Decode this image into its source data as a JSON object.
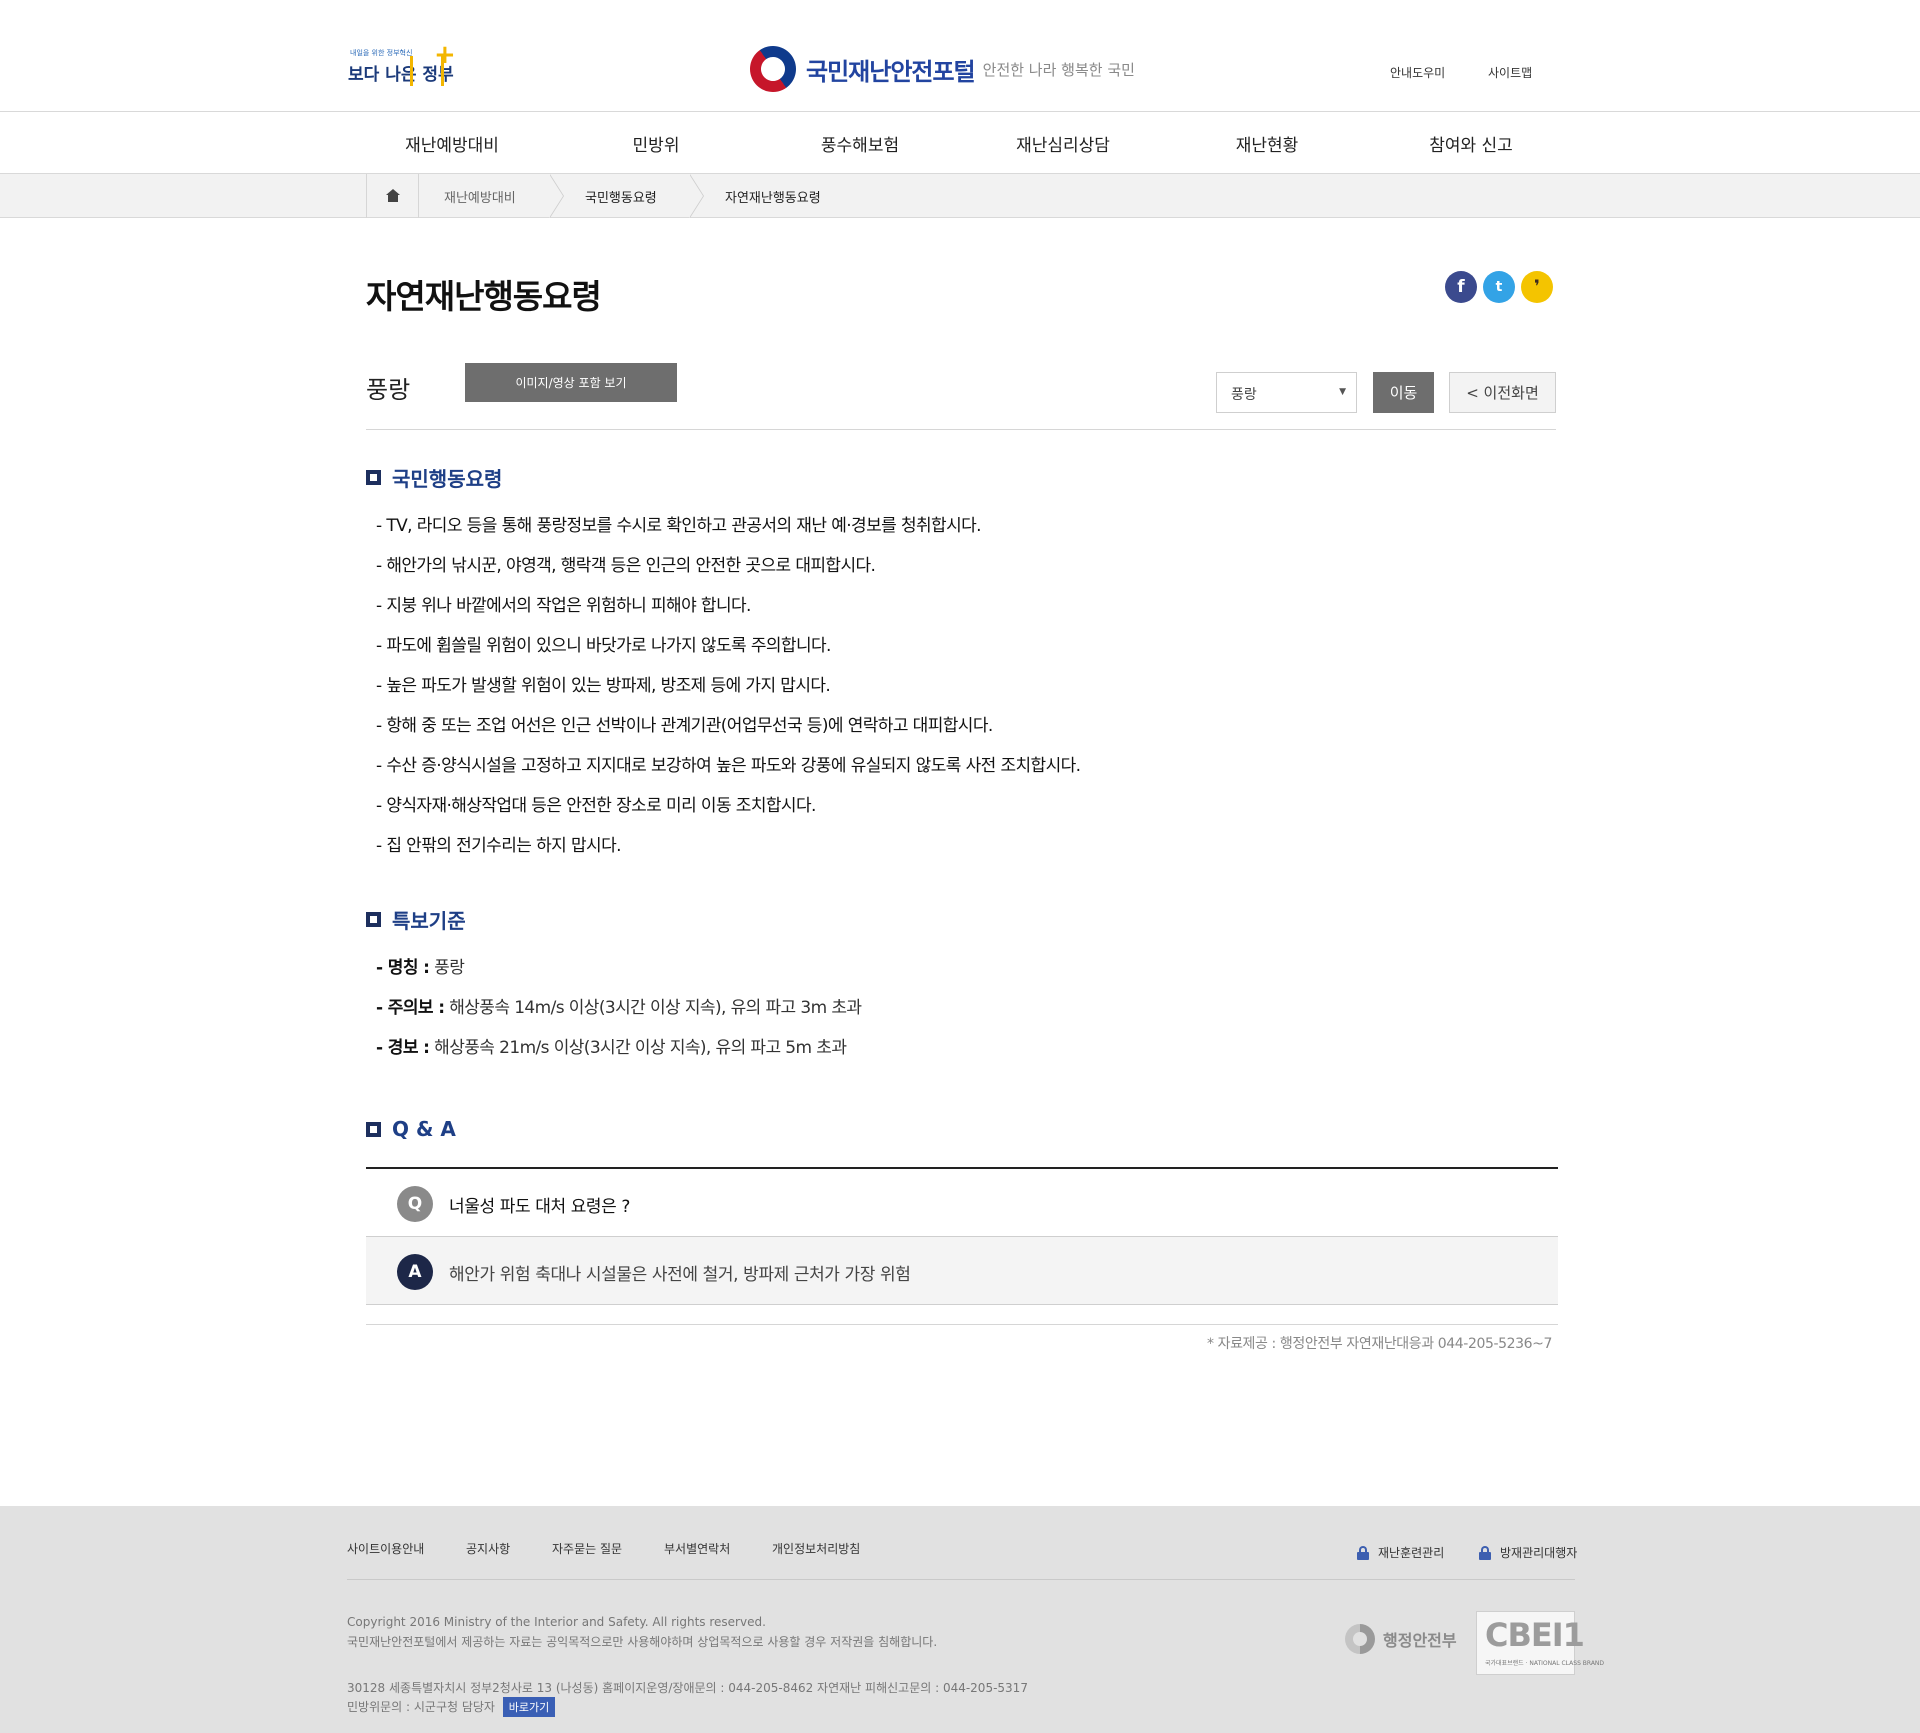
{
  "header": {
    "gov_logo_small": "내일을 위한 정부혁신",
    "gov_logo_big": "보다 나은 정부",
    "site_title": "국민재난안전포털",
    "site_slogan": "안전한 나라 행복한 국민",
    "util_links": [
      "안내도우미",
      "사이트맵"
    ]
  },
  "gnb": [
    "재난예방대비",
    "민방위",
    "풍수해보험",
    "재난심리상담",
    "재난현황",
    "참여와 신고"
  ],
  "breadcrumb": [
    "재난예방대비",
    "국민행동요령",
    "자연재난행동요령"
  ],
  "page": {
    "title": "자연재난행동요령",
    "subtitle": "풍랑",
    "view_button": "이미지/영상 포함 보기",
    "select_value": "풍랑",
    "go_button": "이동",
    "prev_button": "< 이전화면"
  },
  "sns": {
    "facebook": "f",
    "twitter": "t",
    "kakao": "❜"
  },
  "section1": {
    "heading": "국민행동요령",
    "items": [
      "- TV, 라디오 등을 통해 풍랑정보를 수시로 확인하고 관공서의 재난 예·경보를 청취합시다.",
      "- 해안가의 낚시꾼, 야영객, 행락객 등은 인근의 안전한 곳으로 대피합시다.",
      "- 지붕 위나 바깥에서의 작업은 위험하니 피해야 합니다.",
      "- 파도에 휩쓸릴 위험이 있으니 바닷가로 나가지 않도록 주의합니다.",
      "- 높은 파도가 발생할 위험이 있는 방파제, 방조제 등에 가지 맙시다.",
      "- 항해 중 또는 조업 어선은 인근 선박이나 관계기관(어업무선국 등)에 연락하고 대피합시다.",
      "- 수산 증·양식시설을 고정하고 지지대로 보강하여 높은 파도와 강풍에 유실되지 않도록 사전 조치합시다.",
      "- 양식자재·해상작업대 등은 안전한 장소로 미리 이동 조치합시다.",
      "- 집 안팎의 전기수리는 하지 맙시다."
    ]
  },
  "section2": {
    "heading": "특보기준",
    "items": [
      {
        "label": "- 명칭 :",
        "value": " 풍랑"
      },
      {
        "label": "- 주의보 :",
        "value": " 해상풍속 14m/s 이상(3시간 이상 지속), 유의 파고 3m 초과"
      },
      {
        "label": "- 경보 :",
        "value": " 해상풍속 21m/s 이상(3시간 이상 지속), 유의 파고 5m 초과"
      }
    ]
  },
  "section3": {
    "heading": "Q & A",
    "q_badge": "Q",
    "a_badge": "A",
    "question": "너울성 파도 대처 요령은 ?",
    "answer": "해안가 위험 축대나 시설물은 사전에 철거, 방파제 근처가 가장 위험"
  },
  "source_note": "* 자료제공 : 행정안전부 자연재난대응과 044-205-5236~7",
  "footer": {
    "links": [
      "사이트이용안내",
      "공지사항",
      "자주묻는 질문",
      "부서별연락처",
      "개인정보처리방침"
    ],
    "admin_links": [
      "재난훈련관리",
      "방재관리대행자"
    ],
    "copyright": "Copyright 2016 Ministry of the Interior and Safety. All rights reserved.",
    "notice": "국민재난안전포털에서 제공하는 자료는 공익목적으로만 사용해야하며 상업목적으로 사용할 경우 저작권을 침해합니다.",
    "address": "30128 세종특별자치시 정부2청사로 13 (나성동)   홈페이지운영/장애문의 : 044-205-8462   자연재난 피해신고문의 : 044-205-5317",
    "civil_defense": "민방위문의 : 시군구청 담당자",
    "goto_button": "바로가기",
    "ministry": "행정안전부",
    "cbei_mark": "CBEI1",
    "cbei_sub": "국가대표브랜드 · NATIONAL CLASS BRAND"
  },
  "colors": {
    "accent_navy": "#1e3f86",
    "button_gray": "#6e6e6e",
    "footer_bg": "#e1e1e1",
    "facebook": "#3b4a8e",
    "twitter": "#33a3e6",
    "kakao": "#f4c400"
  }
}
